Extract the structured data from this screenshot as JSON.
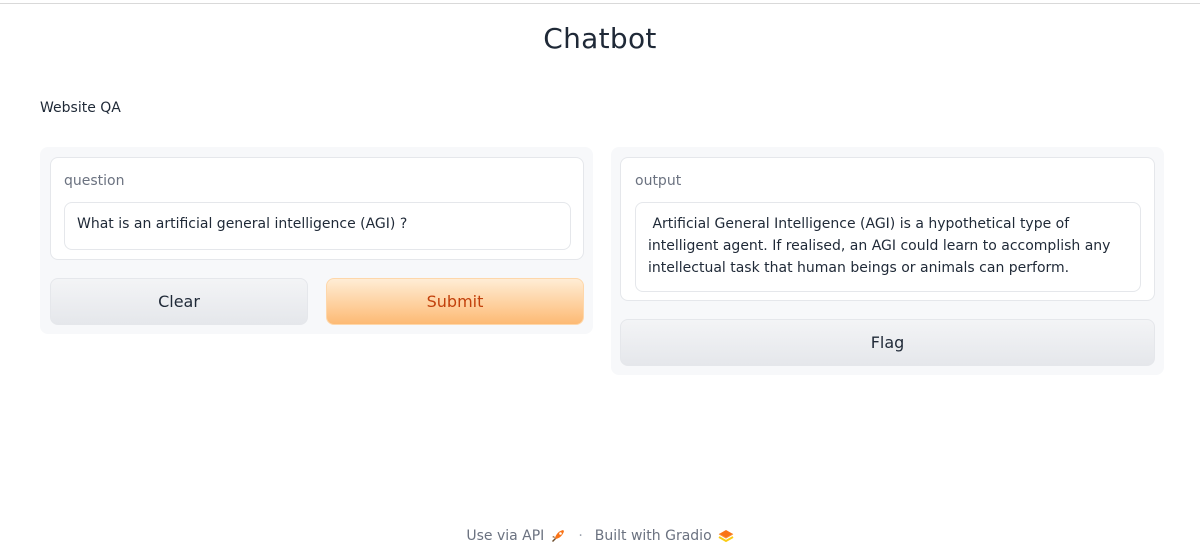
{
  "page": {
    "title": "Chatbot",
    "description": "Website QA"
  },
  "input_panel": {
    "question_label": "question",
    "question_value": "What is an  artificial general intelligence (AGI) ?",
    "clear_label": "Clear",
    "submit_label": "Submit"
  },
  "output_panel": {
    "output_label": "output",
    "output_value": " Artificial General Intelligence (AGI) is a hypothetical type of intelligent agent. If realised, an AGI could learn to accomplish any intellectual task that human beings or animals can perform.",
    "flag_label": "Flag"
  },
  "footer": {
    "api_link": "Use via API",
    "separator": "·",
    "built_with": "Built with Gradio"
  },
  "colors": {
    "primary_accent": "#f97316",
    "primary_text": "#c2410c",
    "panel_bg": "#f7f8fa"
  },
  "icons": {
    "api": "rocket-icon",
    "gradio": "gradio-logo-icon"
  }
}
